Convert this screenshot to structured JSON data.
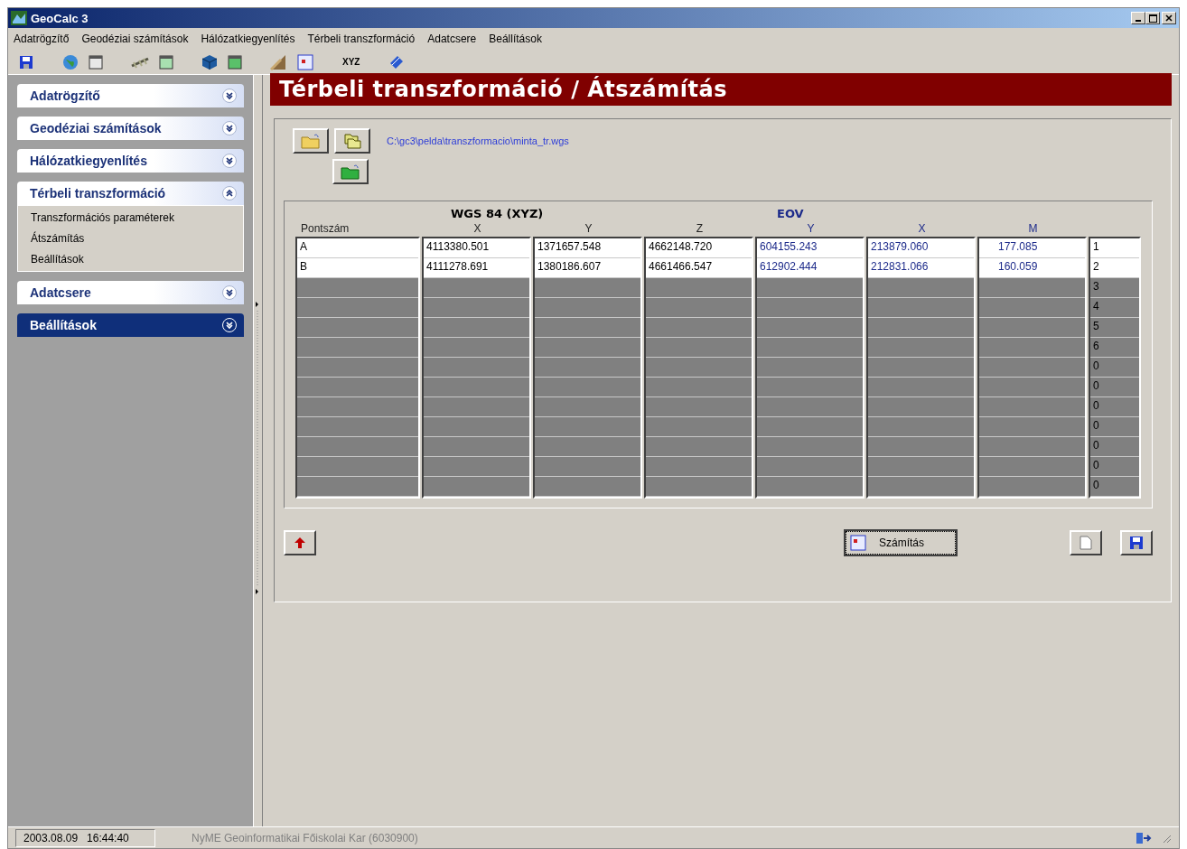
{
  "window": {
    "title": "GeoCalc 3"
  },
  "menu": [
    "Adatrögzítő",
    "Geodéziai számítások",
    "Hálózatkiegyenlítés",
    "Térbeli transzformáció",
    "Adatcsere",
    "Beállítások"
  ],
  "toolbar": {
    "xyz_label": "XYZ"
  },
  "sidebar": {
    "groups": [
      {
        "title": "Adatrögzítő",
        "expanded": false,
        "selected": false
      },
      {
        "title": "Geodéziai számítások",
        "expanded": false,
        "selected": false
      },
      {
        "title": "Hálózatkiegyenlítés",
        "expanded": false,
        "selected": false
      },
      {
        "title": "Térbeli transzformáció",
        "expanded": true,
        "selected": false,
        "items": [
          "Transzformációs paraméterek",
          "Átszámítás",
          "Beállítások"
        ]
      },
      {
        "title": "Adatcsere",
        "expanded": false,
        "selected": false
      },
      {
        "title": "Beállítások",
        "expanded": false,
        "selected": true
      }
    ]
  },
  "header": {
    "title": "Térbeli transzformáció / Átszámítás"
  },
  "file_path": "C:\\gc3\\pelda\\transzformacio\\minta_tr.wgs",
  "grid": {
    "group_wgs": "WGS 84 (XYZ)",
    "group_eov": "EOV",
    "columns": [
      "Pontszám",
      "X",
      "Y",
      "Z",
      "Y",
      "X",
      "M"
    ],
    "rows": [
      {
        "kind": "data",
        "cells": [
          "A",
          "4113380.501",
          "1371657.548",
          "4662148.720",
          "604155.243",
          "213879.060",
          "177.085"
        ],
        "number": "1"
      },
      {
        "kind": "data",
        "cells": [
          "B",
          "4111278.691",
          "1380186.607",
          "4661466.547",
          "612902.444",
          "212831.066",
          "160.059"
        ],
        "number": "2"
      },
      {
        "kind": "empty",
        "number": "3"
      },
      {
        "kind": "empty",
        "number": "4"
      },
      {
        "kind": "empty",
        "number": "5"
      },
      {
        "kind": "empty",
        "number": "6"
      },
      {
        "kind": "empty",
        "number": "0"
      },
      {
        "kind": "empty",
        "number": "0"
      },
      {
        "kind": "empty",
        "number": "0"
      },
      {
        "kind": "empty",
        "number": "0"
      },
      {
        "kind": "empty",
        "number": "0"
      },
      {
        "kind": "empty",
        "number": "0"
      },
      {
        "kind": "empty",
        "number": "0"
      }
    ]
  },
  "calc_button": "Számítás",
  "status_bar": {
    "datetime": "2003.08.09   16:44:40",
    "org": "NyME Geoinformatikai Főiskolai Kar (6030900)"
  }
}
